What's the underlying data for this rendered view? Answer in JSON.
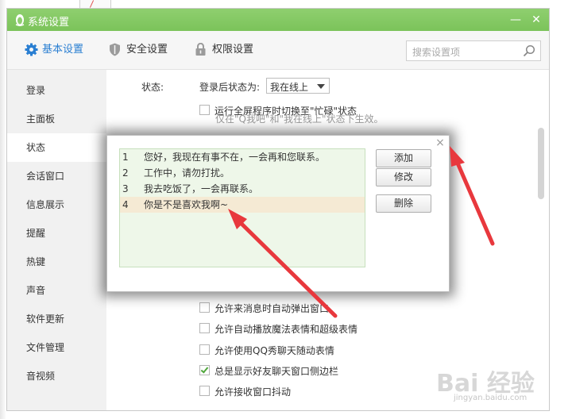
{
  "window": {
    "title": "系统设置",
    "minimize_glyph": "—",
    "close_glyph": "✕"
  },
  "toolbar": {
    "tabs": [
      {
        "label": "基本设置",
        "icon": "gear-icon",
        "active": true
      },
      {
        "label": "安全设置",
        "icon": "shield-icon",
        "active": false
      },
      {
        "label": "权限设置",
        "icon": "lock-icon",
        "active": false
      }
    ],
    "search_placeholder": "搜索设置项"
  },
  "sidebar": {
    "items": [
      {
        "label": "登录"
      },
      {
        "label": "主面板"
      },
      {
        "label": "状态",
        "active": true
      },
      {
        "label": "会话窗口"
      },
      {
        "label": "信息展示"
      },
      {
        "label": "提醒"
      },
      {
        "label": "热键"
      },
      {
        "label": "声音"
      },
      {
        "label": "软件更新"
      },
      {
        "label": "文件管理"
      },
      {
        "label": "音视频"
      }
    ]
  },
  "content": {
    "status_label": "状态:",
    "after_login_label": "登录后状态为:",
    "status_value": "我在线上",
    "fullscreen_option": "运行全屏程序时切换至\"忙碌\"状态",
    "fullscreen_hint": "仅在\"Q我吧\"和\"我在线上\"状态下生效。",
    "options": [
      {
        "label": "允许来消息时自动弹出窗口",
        "checked": false
      },
      {
        "label": "允许自动播放魔法表情和超级表情",
        "checked": false
      },
      {
        "label": "允许使用QQ秀聊天随动表情",
        "checked": false
      },
      {
        "label": "总是显示好友聊天窗口侧边栏",
        "checked": true
      },
      {
        "label": "允许接收窗口抖动",
        "checked": false
      }
    ]
  },
  "dialog": {
    "close_glyph": "×",
    "replies": [
      {
        "num": "1",
        "text": "您好，我现在有事不在，一会再和您联系。"
      },
      {
        "num": "2",
        "text": "工作中，请勿打扰。"
      },
      {
        "num": "3",
        "text": "我去吃饭了，一会再联系。"
      },
      {
        "num": "4",
        "text": "你是不是喜欢我啊~",
        "selected": true
      }
    ],
    "buttons": {
      "add": "添加",
      "edit": "修改",
      "delete": "删除"
    }
  },
  "watermark": {
    "main": "Bai 经验",
    "sub": "jingyan.baidu.com"
  },
  "colors": {
    "title_bar": "#7bc35a",
    "accent": "#2a7fd2",
    "arrow": "#e8383d",
    "check": "#4ea63a"
  }
}
